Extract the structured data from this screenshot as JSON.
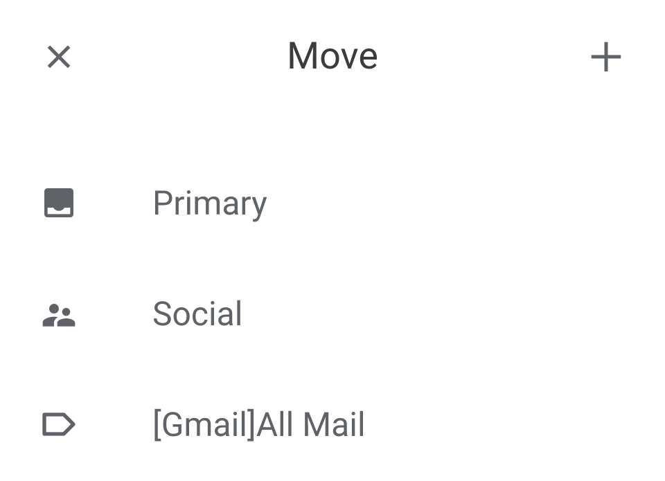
{
  "header": {
    "title": "Move"
  },
  "items": [
    {
      "label": "Primary"
    },
    {
      "label": "Social"
    },
    {
      "label": "[Gmail]All Mail"
    }
  ],
  "colors": {
    "icon": "#5f6368",
    "text": "#5f6368",
    "title": "#3c3c3c"
  }
}
